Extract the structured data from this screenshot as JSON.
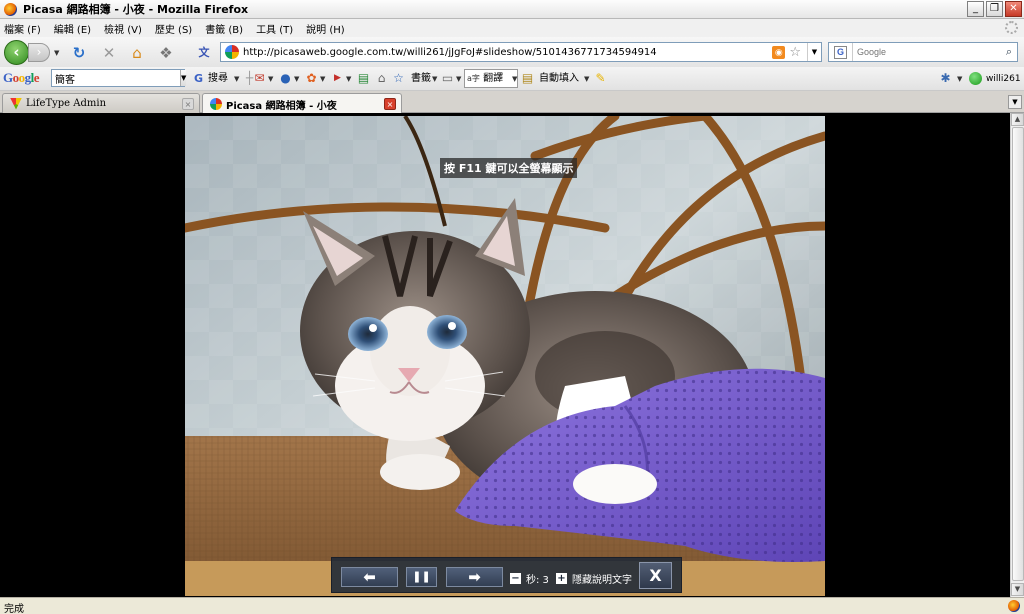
{
  "window": {
    "title": "Picasa 網路相簿 - 小夜 - Mozilla Firefox",
    "minimize": "_",
    "restore": "❐",
    "close": "✕"
  },
  "menu": [
    {
      "label": "檔案 (F)"
    },
    {
      "label": "編輯 (E)"
    },
    {
      "label": "檢視 (V)"
    },
    {
      "label": "歷史 (S)"
    },
    {
      "label": "書籤 (B)"
    },
    {
      "label": "工具 (T)"
    },
    {
      "label": "說明 (H)"
    }
  ],
  "nav": {
    "back": "‹",
    "forward": "›",
    "url": "http://picasaweb.google.com.tw/willi261/jJgFoJ#slideshow/5101436771734594914",
    "search_placeholder": "Google"
  },
  "google_toolbar": {
    "logo": "Google",
    "search_value": "簡客",
    "search_label": "搜尋",
    "bookmarks_label": "書籤",
    "translate_label": "翻譯",
    "autofill_label": "自動填入",
    "user_label": "willi261"
  },
  "tabs": [
    {
      "label": "LifeType Admin",
      "close": "×"
    },
    {
      "label": "Picasa 網路相簿 - 小夜",
      "close": "×"
    }
  ],
  "slideshow": {
    "hint": "按 F11 鍵可以全螢幕顯示",
    "prev": "⬅",
    "pause": "❚❚",
    "next": "➡",
    "minus": "−",
    "seconds_label": "秒: 3",
    "plus": "+",
    "hide_caption": "隱藏說明文字",
    "close": "X"
  },
  "status": {
    "text": "完成"
  },
  "colors": {
    "accent_green": "#2f8a1e",
    "tab_close_red": "#d8402c",
    "slideshow_bg": "#000000"
  }
}
